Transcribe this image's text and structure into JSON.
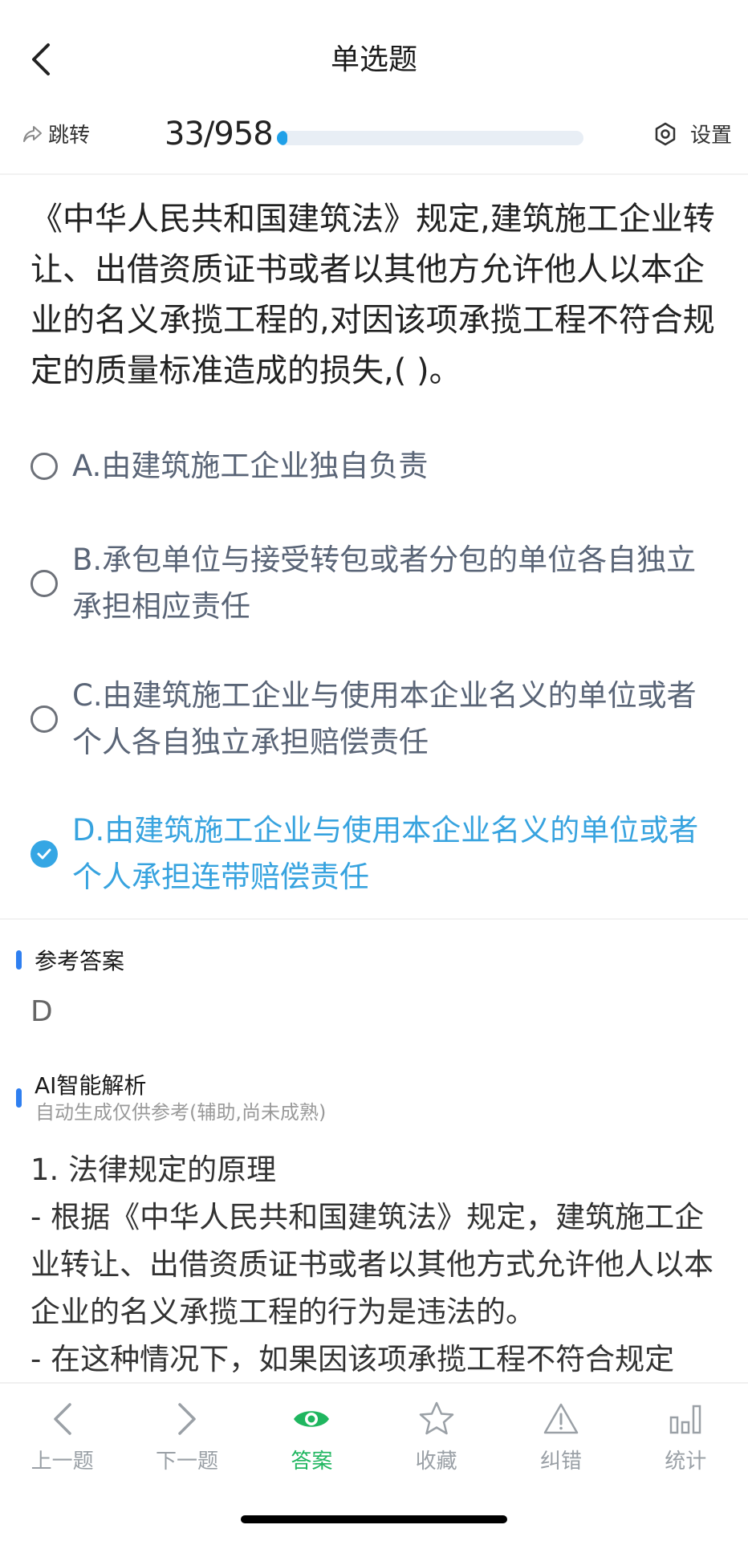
{
  "header": {
    "title": "单选题"
  },
  "progress": {
    "jump_label": "跳转",
    "count": "33/958",
    "current": 33,
    "total": 958,
    "settings_label": "设置"
  },
  "question": {
    "text": "《中华人民共和国建筑法》规定,建筑施工企业转让、出借资质证书或者以其他方允许他人以本企业的名义承揽工程的,对因该项承揽工程不符合规定的质量标准造成的损失,( )。"
  },
  "options": [
    {
      "text": "A.由建筑施工企业独自负责",
      "selected": false
    },
    {
      "text": "B.承包单位与接受转包或者分包的单位各自独立承担相应责任",
      "selected": false
    },
    {
      "text": "C.由建筑施工企业与使用本企业名义的单位或者个人各自独立承担赔偿责任",
      "selected": false
    },
    {
      "text": "D.由建筑施工企业与使用本企业名义的单位或者个人承担连带赔偿责任",
      "selected": true
    }
  ],
  "answer": {
    "title": "参考答案",
    "value": "D"
  },
  "ai": {
    "title": "AI智能解析",
    "subtitle": "自动生成仅供参考(辅助,尚未成熟)",
    "lines": [
      "1. 法律规定的原理",
      "- 根据《中华人民共和国建筑法》规定，建筑施工企业转让、出借资质证书或者以其他方式允许他人以本企业的名义承揽工程的行为是违法的。",
      "- 在这种情况下，如果因该项承揽工程不符合规定"
    ]
  },
  "toolbar": {
    "items": [
      {
        "label": "上一题",
        "icon": "chevron-left-icon"
      },
      {
        "label": "下一题",
        "icon": "chevron-right-icon"
      },
      {
        "label": "答案",
        "icon": "eye-icon"
      },
      {
        "label": "收藏",
        "icon": "star-icon"
      },
      {
        "label": "纠错",
        "icon": "warning-icon"
      },
      {
        "label": "统计",
        "icon": "bar-chart-icon"
      }
    ],
    "active_color": "#1fb65f",
    "inactive_color": "#9aa0a6"
  },
  "colors": {
    "accent_blue": "#35a6e4",
    "progress_fill": "#1fa0e8",
    "section_bar": "#2f7ff0"
  }
}
